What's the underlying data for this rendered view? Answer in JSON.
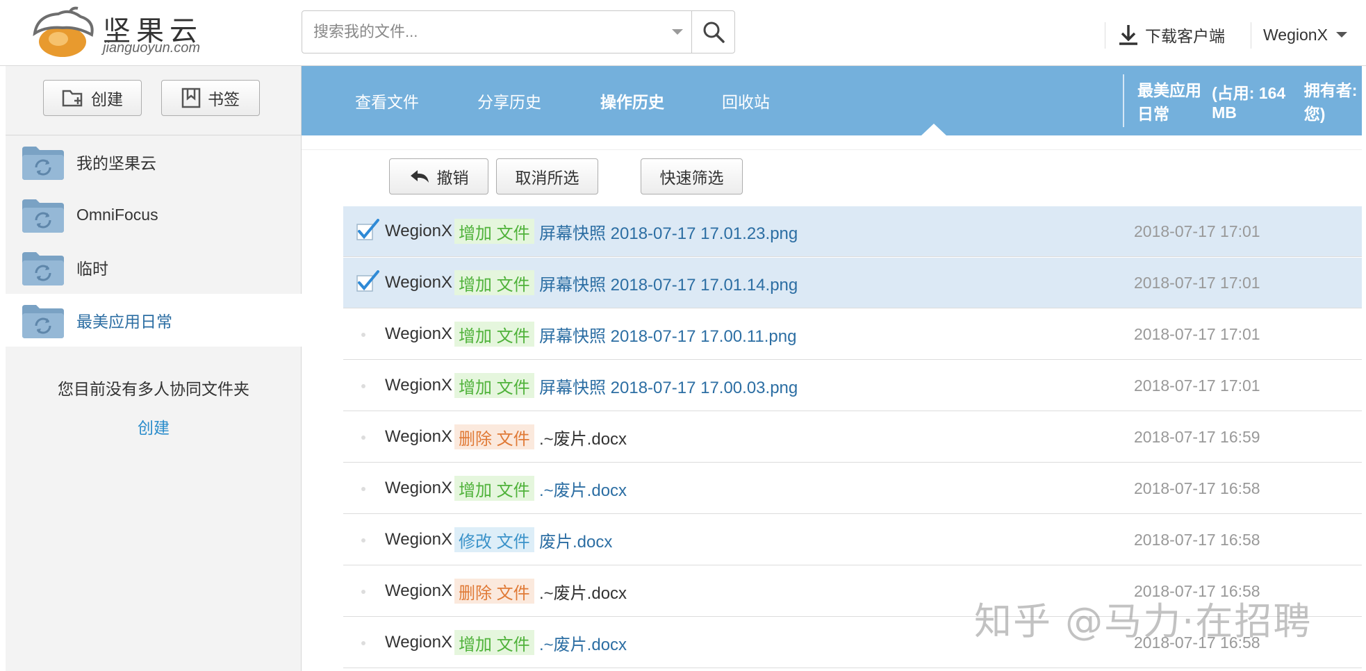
{
  "header": {
    "logo_cn": "坚果云",
    "logo_en": "jianguoyun.com",
    "search_placeholder": "搜索我的文件...",
    "download_label": "下载客户端",
    "user_name": "WegionX"
  },
  "sidebar": {
    "create_label": "创建",
    "bookmark_label": "书签",
    "folders": [
      {
        "label": "我的坚果云"
      },
      {
        "label": "OmniFocus"
      },
      {
        "label": "临时"
      },
      {
        "label": "最美应用日常"
      }
    ],
    "no_shared_text": "您目前没有多人协同文件夹",
    "create_link": "创建"
  },
  "tabs": [
    {
      "label": "查看文件"
    },
    {
      "label": "分享历史"
    },
    {
      "label": "操作历史"
    },
    {
      "label": "回收站"
    }
  ],
  "library_info": {
    "name": "最美应用日常",
    "usage": "(占用: 164 MB",
    "owner": "拥有者: 您)"
  },
  "toolbar": {
    "undo_label": "撤销",
    "deselect_label": "取消所选",
    "filter_label": "快速筛选"
  },
  "history": [
    {
      "user": "WegionX",
      "action": "增加 文件",
      "file": "屏幕快照 2018-07-17 17.01.23.png",
      "time": "2018-07-17 17:01",
      "checked": true
    },
    {
      "user": "WegionX",
      "action": "增加 文件",
      "file": "屏幕快照 2018-07-17 17.01.14.png",
      "time": "2018-07-17 17:01",
      "checked": true
    },
    {
      "user": "WegionX",
      "action": "增加 文件",
      "file": "屏幕快照 2018-07-17 17.00.11.png",
      "time": "2018-07-17 17:01",
      "checked": false
    },
    {
      "user": "WegionX",
      "action": "增加 文件",
      "file": "屏幕快照 2018-07-17 17.00.03.png",
      "time": "2018-07-17 17:01",
      "checked": false
    },
    {
      "user": "WegionX",
      "action": "删除 文件",
      "file": ".~废片.docx",
      "time": "2018-07-17 16:59",
      "checked": false
    },
    {
      "user": "WegionX",
      "action": "增加 文件",
      "file": ".~废片.docx",
      "time": "2018-07-17 16:58",
      "checked": false
    },
    {
      "user": "WegionX",
      "action": "修改 文件",
      "file": "废片.docx",
      "time": "2018-07-17 16:58",
      "checked": false
    },
    {
      "user": "WegionX",
      "action": "删除 文件",
      "file": ".~废片.docx",
      "time": "2018-07-17 16:58",
      "checked": false
    },
    {
      "user": "WegionX",
      "action": "增加 文件",
      "file": ".~废片.docx",
      "time": "2018-07-17 16:58",
      "checked": false
    }
  ],
  "watermark": "知乎 @马力·在招聘",
  "colors": {
    "tab_bar": "#74b0dc",
    "selected_row": "#dce9f5",
    "add_badge": "#4fb23a",
    "delete_badge": "#e07a36",
    "modify_badge": "#3a92c9",
    "link": "#2c6ea3"
  }
}
